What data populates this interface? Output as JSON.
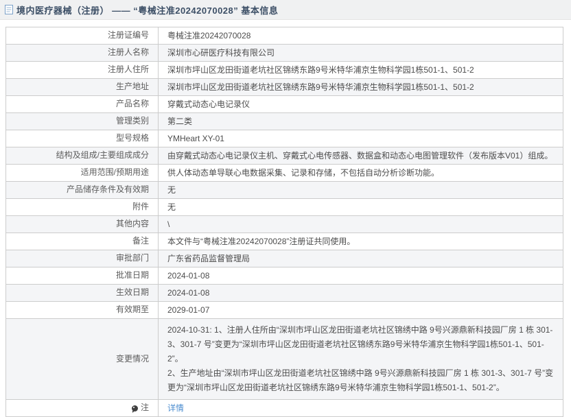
{
  "page": {
    "title": "境内医疗器械（注册） —— “粤械注准20242070028” 基本信息"
  },
  "colors": {
    "title_text": "#3c4f66",
    "titlebar_bg": "#f0f1f2",
    "row_alt_bg": "#f4f5f7",
    "border": "#cccccc",
    "label_text": "#5c5c5c",
    "value_text": "#4c4c4c",
    "link": "#4d8ed0"
  },
  "table": {
    "rows": [
      {
        "label": "注册证编号",
        "value": "粤械注准20242070028"
      },
      {
        "label": "注册人名称",
        "value": "深圳市心研医疗科技有限公司"
      },
      {
        "label": "注册人住所",
        "value": "深圳市坪山区龙田街道老坑社区锦绣东路9号米特华浦京生物科学园1栋501-1、501-2"
      },
      {
        "label": "生产地址",
        "value": "深圳市坪山区龙田街道老坑社区锦绣东路9号米特华浦京生物科学园1栋501-1、501-2"
      },
      {
        "label": "产品名称",
        "value": "穿戴式动态心电记录仪"
      },
      {
        "label": "管理类别",
        "value": "第二类"
      },
      {
        "label": "型号规格",
        "value": "YMHeart XY-01"
      },
      {
        "label": "结构及组成/主要组成成分",
        "value": "由穿戴式动态心电记录仪主机、穿戴式心电传感器、数据盒和动态心电图管理软件（发布版本V01）组成。"
      },
      {
        "label": "适用范围/预期用途",
        "value": "供人体动态单导联心电数据采集、记录和存储，不包括自动分析诊断功能。"
      },
      {
        "label": "产品储存条件及有效期",
        "value": "无"
      },
      {
        "label": "附件",
        "value": "无"
      },
      {
        "label": "其他内容",
        "value": "\\"
      },
      {
        "label": "备注",
        "value": "本文件与“粤械注准20242070028”注册证共同使用。"
      },
      {
        "label": "审批部门",
        "value": "广东省药品监督管理局"
      },
      {
        "label": "批准日期",
        "value": "2024-01-08"
      },
      {
        "label": "生效日期",
        "value": "2024-01-08"
      },
      {
        "label": "有效期至",
        "value": "2029-01-07"
      },
      {
        "label": "变更情况",
        "lines": [
          "2024-10-31: 1、注册人住所由“深圳市坪山区龙田街道老坑社区锦绣中路 9号兴源鼎新科技园厂房 1 栋 301-3、301-7 号”变更为“深圳市坪山区龙田街道老坑社区锦绣东路9号米特华浦京生物科学园1栋501-1、501-2”。",
          "2、生产地址由“深圳市坪山区龙田街道老坑社区锦绣中路 9号兴源鼎新科技园厂房 1 栋 301-3、301-7 号”变更为“深圳市坪山区龙田街道老坑社区锦绣东路9号米特华浦京生物科学园1栋501-1、501-2”。"
        ]
      },
      {
        "label": "注",
        "value": "详情"
      }
    ]
  }
}
